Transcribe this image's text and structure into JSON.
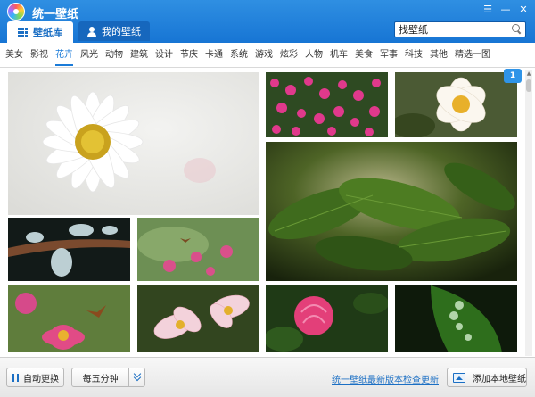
{
  "app": {
    "title": "统一壁纸"
  },
  "tabs": [
    {
      "label": "壁纸库",
      "active": true
    },
    {
      "label": "我的壁纸",
      "active": false
    }
  ],
  "search": {
    "value": "找壁纸",
    "placeholder": "找壁纸"
  },
  "categories": [
    "美女",
    "影视",
    "花卉",
    "风光",
    "动物",
    "建筑",
    "设计",
    "节庆",
    "卡通",
    "系统",
    "游戏",
    "炫彩",
    "人物",
    "机车",
    "美食",
    "军事",
    "科技",
    "其他",
    "精选一图"
  ],
  "active_category": "花卉",
  "gallery": {
    "page_badge": "1",
    "thumbnails": [
      {
        "subject": "white daisy"
      },
      {
        "subject": "pink flower field"
      },
      {
        "subject": "white peony"
      },
      {
        "subject": "green leaves"
      },
      {
        "subject": "water drops on branch"
      },
      {
        "subject": "pink flowers with butterfly"
      },
      {
        "subject": "pink zinnia with butterfly"
      },
      {
        "subject": "pink and white lilies"
      },
      {
        "subject": "pink peony bud"
      },
      {
        "subject": "dew drops on leaf"
      }
    ]
  },
  "colors": {
    "titlebar": "#1e7fd9",
    "accent": "#1b7bd8",
    "link": "#1b6fc4"
  },
  "bottom": {
    "auto_change": "自动更换",
    "interval": "每五分钟",
    "update_link": "统一壁纸最新版本检查更新",
    "add_local": "添加本地壁纸"
  }
}
